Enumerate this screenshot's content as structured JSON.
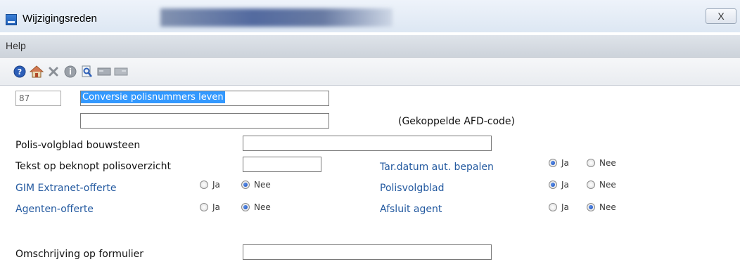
{
  "window": {
    "title": "Wijzigingsreden",
    "close_label": "X"
  },
  "menu": {
    "items": [
      {
        "label": "Help"
      }
    ]
  },
  "toolbar": {
    "buttons": [
      "help-icon",
      "home-icon",
      "delete-icon",
      "info-icon",
      "search-icon",
      "card-icon",
      "card-icon-2"
    ]
  },
  "form": {
    "code": "87",
    "description": "Conversie polisnummers leven",
    "afd_code_value": "",
    "afd_code_note": "(Gekoppelde AFD-code)",
    "polis_volgblad_bouwsteen": {
      "label": "Polis-volgblad bouwsteen",
      "value": ""
    },
    "tekst_beknopt": {
      "label": "Tekst op beknopt polisoverzicht",
      "value": ""
    },
    "gim_extranet": {
      "label": "GIM Extranet-offerte",
      "selected": "Nee"
    },
    "agenten_offerte": {
      "label": "Agenten-offerte",
      "selected": "Nee"
    },
    "tar_datum": {
      "label": "Tar.datum aut. bepalen",
      "selected": "Ja"
    },
    "polisvolgblad": {
      "label": "Polisvolgblad",
      "selected": "Ja"
    },
    "afsluit_agent": {
      "label": "Afsluit agent",
      "selected": "Nee"
    },
    "omschrijving": {
      "label": "Omschrijving op formulier",
      "value": ""
    },
    "option_yes": "Ja",
    "option_no": "Nee"
  }
}
